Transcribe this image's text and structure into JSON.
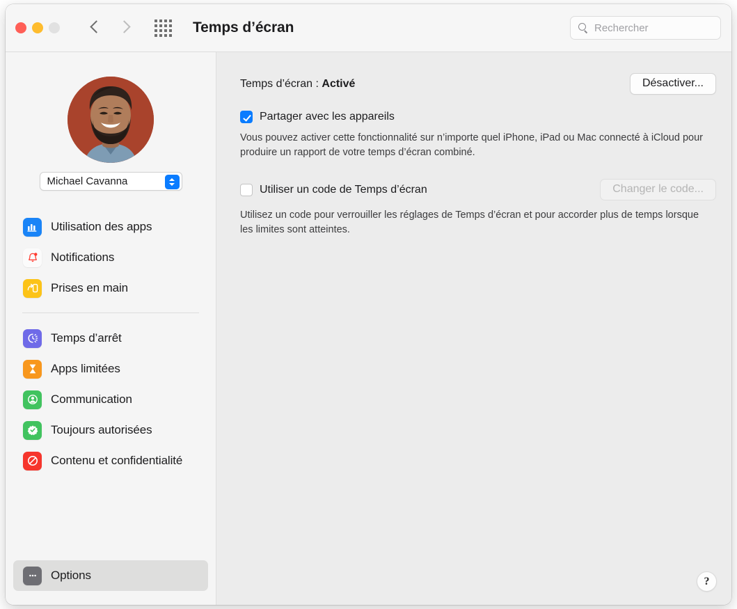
{
  "window": {
    "title": "Temps d’écran",
    "traffic_lights": [
      "close",
      "minimize",
      "zoom"
    ]
  },
  "toolbar": {
    "back_icon": "chevron-left-icon",
    "forward_icon": "chevron-right-icon",
    "grid_icon": "show-all-preferences-icon",
    "search": {
      "placeholder": "Rechercher",
      "value": "",
      "icon": "search-icon"
    }
  },
  "sidebar": {
    "avatar": {
      "name": "avatar",
      "background_color": "#a9432c"
    },
    "account_popup": {
      "value": "Michael Cavanna",
      "icon": "up-down-chevron-icon"
    },
    "groups": [
      {
        "items": [
          {
            "label": "Utilisation des apps",
            "icon": "app-usage-icon",
            "color": "#1a84f7",
            "selected": false
          },
          {
            "label": "Notifications",
            "icon": "bell-icon",
            "color": "#fbfbfb",
            "selected": false
          },
          {
            "label": "Prises en main",
            "icon": "pickups-icon",
            "color": "#fcc318",
            "selected": false
          }
        ]
      },
      {
        "items": [
          {
            "label": "Temps d’arrêt",
            "icon": "downtime-icon",
            "color": "#6f6ae8",
            "selected": false
          },
          {
            "label": "Apps limitées",
            "icon": "hourglass-icon",
            "color": "#f8971d",
            "selected": false
          },
          {
            "label": "Communication",
            "icon": "person-circle-icon",
            "color": "#41c35f",
            "selected": false
          },
          {
            "label": "Toujours autorisées",
            "icon": "check-badge-icon",
            "color": "#41c35f",
            "selected": false
          },
          {
            "label": "Contenu et confidentialité",
            "icon": "no-entry-icon",
            "color": "#f6352c",
            "selected": false
          }
        ]
      }
    ],
    "options": {
      "label": "Options",
      "icon": "ellipsis-icon",
      "color": "#6e6e73",
      "selected": true
    }
  },
  "content": {
    "status": {
      "label": "Temps d’écran :",
      "value": "Activé"
    },
    "turn_off_button": "Désactiver...",
    "share_checkbox": {
      "label": "Partager avec les appareils",
      "checked": true
    },
    "share_description": "Vous pouvez activer cette fonctionnalité sur n’importe quel iPhone, iPad ou Mac connecté à iCloud pour produire un rapport de votre temps d’écran combiné.",
    "passcode_checkbox": {
      "label": "Utiliser un code de Temps d’écran",
      "checked": false
    },
    "change_passcode_button": {
      "label": "Changer le code...",
      "disabled": true
    },
    "passcode_description": "Utilisez un code pour verrouiller les réglages de Temps d’écran et pour accorder plus de temps lorsque les limites sont atteintes.",
    "help_button": "?"
  }
}
